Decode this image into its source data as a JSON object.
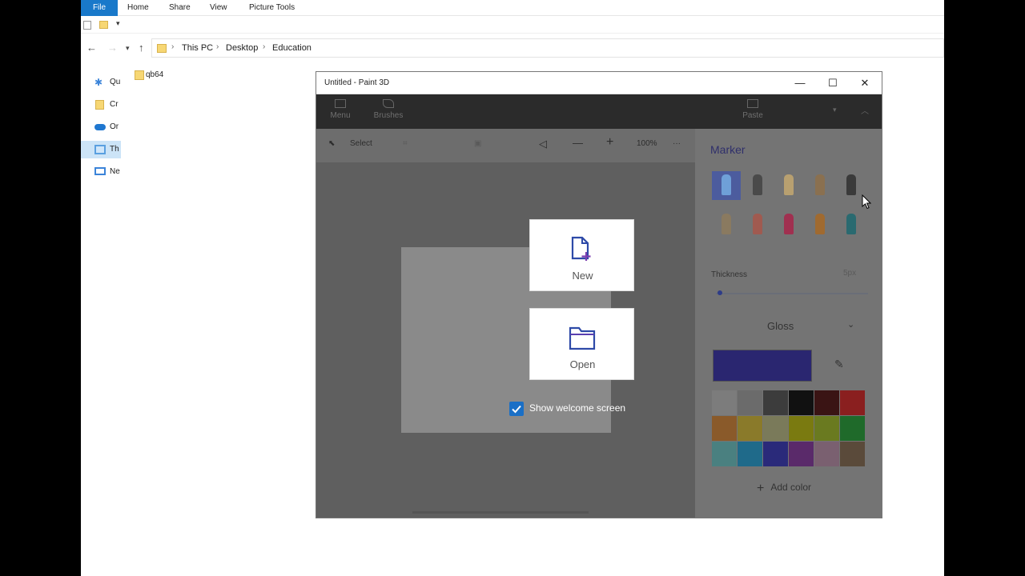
{
  "explorer": {
    "ribbon_tabs": [
      "File",
      "Home",
      "Share",
      "View",
      "Picture Tools"
    ],
    "breadcrumb": [
      "This PC",
      "Desktop",
      "Education"
    ],
    "nav_items": [
      {
        "label": "Qu",
        "icon": "pin-icon",
        "color": "#3b84d9"
      },
      {
        "label": "Cr",
        "icon": "folder-icon",
        "color": "#f7d774"
      },
      {
        "label": "Or",
        "icon": "cloud-icon",
        "color": "#1f77d0"
      },
      {
        "label": "Th",
        "icon": "computer-icon",
        "color": "#5aa0e0"
      },
      {
        "label": "Ne",
        "icon": "network-icon",
        "color": "#3b84d9"
      }
    ],
    "selected_nav": 3,
    "files": [
      "qb64"
    ]
  },
  "paint": {
    "title": "Untitled - Paint 3D",
    "toolbar": {
      "menu": "Menu",
      "brushes": "Brushes",
      "paste": "Paste"
    },
    "actions": {
      "select": "Select",
      "zoom": "100%",
      "more": "···"
    },
    "panel": {
      "title": "Marker",
      "thickness_label": "Thickness",
      "thickness_value": "5px",
      "finish": "Gloss",
      "current_color": "#2a2670",
      "add_color": "Add color"
    },
    "brushes": [
      {
        "name": "marker-brush",
        "color": "#6fa0d8"
      },
      {
        "name": "calligraphy-pen-brush",
        "color": "#4a4a4a"
      },
      {
        "name": "oil-brush",
        "color": "#b8a070"
      },
      {
        "name": "watercolor-brush",
        "color": "#8a7050"
      },
      {
        "name": "pixel-pen-brush",
        "color": "#3a3a3a"
      },
      {
        "name": "pencil-brush",
        "color": "#8a7a60"
      },
      {
        "name": "eraser-brush",
        "color": "#a05a50"
      },
      {
        "name": "crayon-brush",
        "color": "#a03050"
      },
      {
        "name": "spray-can-brush",
        "color": "#a06a30"
      },
      {
        "name": "fill-brush",
        "color": "#2a6a70"
      }
    ],
    "palette": [
      "#7c7c7c",
      "#6b6b6b",
      "#3c3c3c",
      "#111111",
      "#3a1414",
      "#8a1f1f",
      "#8a5a2a",
      "#8a7a2a",
      "#7a7a5a",
      "#7a7a10",
      "#6a7a20",
      "#1f6a2a",
      "#4a8080",
      "#1f6a8a",
      "#2a2a7a",
      "#5a2a6a",
      "#7a6070",
      "#5a4a3a"
    ],
    "welcome": {
      "new": "New",
      "open": "Open",
      "show_welcome": "Show welcome screen"
    }
  }
}
